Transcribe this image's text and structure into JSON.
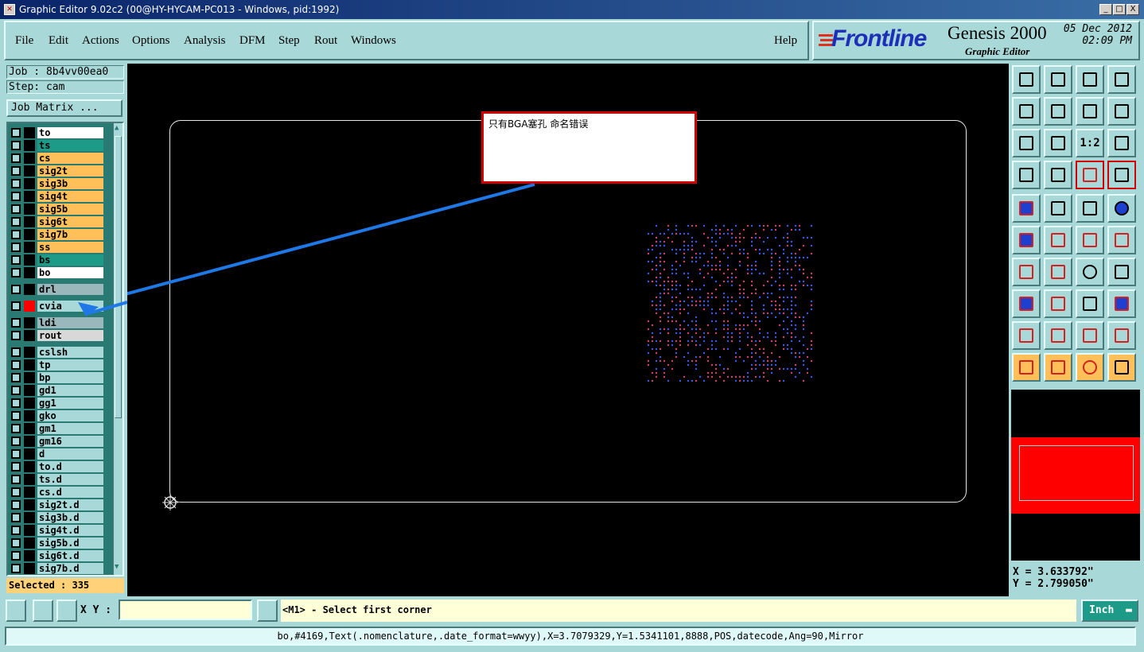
{
  "window": {
    "title": "Graphic Editor 9.02c2 (00@HY-HYCAM-PC013 - Windows, pid:1992)",
    "min": "_",
    "max": "□",
    "close": "X"
  },
  "menu": [
    "File",
    "Edit",
    "Actions",
    "Options",
    "Analysis",
    "DFM",
    "Step",
    "Rout",
    "Windows"
  ],
  "help_label": "Help",
  "brand": {
    "logo": "Frontline",
    "product": "Genesis 2000",
    "subtitle": "Graphic Editor",
    "date": "05 Dec 2012",
    "time": "02:09 PM"
  },
  "job": {
    "job_line": "Job : 8b4vv00ea0",
    "step_line": "Step: cam",
    "matrix_button": "Job Matrix ..."
  },
  "layers": [
    {
      "name": "to",
      "color": "#ffffff",
      "swatch": "#000000"
    },
    {
      "name": "ts",
      "color": "#1e9a88",
      "swatch": "#000000"
    },
    {
      "name": "cs",
      "color": "#ffc05a",
      "swatch": "#000000"
    },
    {
      "name": "sig2t",
      "color": "#ffc05a",
      "swatch": "#000000"
    },
    {
      "name": "sig3b",
      "color": "#ffc05a",
      "swatch": "#000000"
    },
    {
      "name": "sig4t",
      "color": "#ffc05a",
      "swatch": "#000000"
    },
    {
      "name": "sig5b",
      "color": "#ffc05a",
      "swatch": "#000000"
    },
    {
      "name": "sig6t",
      "color": "#ffc05a",
      "swatch": "#000000"
    },
    {
      "name": "sig7b",
      "color": "#ffc05a",
      "swatch": "#000000"
    },
    {
      "name": "ss",
      "color": "#ffc05a",
      "swatch": "#000000"
    },
    {
      "name": "bs",
      "color": "#1e9a88",
      "swatch": "#000000"
    },
    {
      "name": "bo",
      "color": "#ffffff",
      "swatch": "#000000"
    },
    {
      "name": "drl",
      "color": "#9ab8bc",
      "swatch": "#000000"
    },
    {
      "name": "cvia",
      "color": "#a9d8d8",
      "swatch": "#ff0000"
    },
    {
      "name": "ldi",
      "color": "#9ab8bc",
      "swatch": "#000000"
    },
    {
      "name": "rout",
      "color": "#d8d8d8",
      "swatch": "#000000"
    },
    {
      "name": "cslsh",
      "color": "#a9d8d8",
      "swatch": "#000000"
    },
    {
      "name": "tp",
      "color": "#a9d8d8",
      "swatch": "#000000"
    },
    {
      "name": "bp",
      "color": "#a9d8d8",
      "swatch": "#000000"
    },
    {
      "name": "gd1",
      "color": "#a9d8d8",
      "swatch": "#000000"
    },
    {
      "name": "gg1",
      "color": "#a9d8d8",
      "swatch": "#000000"
    },
    {
      "name": "gko",
      "color": "#a9d8d8",
      "swatch": "#000000"
    },
    {
      "name": "gm1",
      "color": "#a9d8d8",
      "swatch": "#000000"
    },
    {
      "name": "gm16",
      "color": "#a9d8d8",
      "swatch": "#000000"
    },
    {
      "name": "d",
      "color": "#a9d8d8",
      "swatch": "#000000"
    },
    {
      "name": "to.d",
      "color": "#a9d8d8",
      "swatch": "#000000"
    },
    {
      "name": "ts.d",
      "color": "#a9d8d8",
      "swatch": "#000000"
    },
    {
      "name": "cs.d",
      "color": "#a9d8d8",
      "swatch": "#000000"
    },
    {
      "name": "sig2t.d",
      "color": "#a9d8d8",
      "swatch": "#000000"
    },
    {
      "name": "sig3b.d",
      "color": "#a9d8d8",
      "swatch": "#000000"
    },
    {
      "name": "sig4t.d",
      "color": "#a9d8d8",
      "swatch": "#000000"
    },
    {
      "name": "sig5b.d",
      "color": "#a9d8d8",
      "swatch": "#000000"
    },
    {
      "name": "sig6t.d",
      "color": "#a9d8d8",
      "swatch": "#000000"
    },
    {
      "name": "sig7b.d",
      "color": "#a9d8d8",
      "swatch": "#000000"
    }
  ],
  "selected": "Selected : 335",
  "annotation": "只有BGA塞孔  命名错误",
  "coords": {
    "x": "X = 3.633792\"",
    "y": "Y = 2.799050\""
  },
  "bottom": {
    "xy_label": "X Y :",
    "xy_value": "",
    "prompt": "<M1> - Select first corner",
    "unit": "Inch"
  },
  "status": "bo,#4169,Text(.nomenclature,.date_format=wwyy),X=3.7079329,Y=1.5341101,8888,POS,datecode,Ang=90,Mirror",
  "toolbar_icons": [
    "home-icon",
    "zoom-home-icon",
    "house-icon",
    "grid-corner-icon",
    "pan-left-icon",
    "pan-right-icon",
    "flip-icon",
    "step-s-icon",
    "fit-width-icon",
    "fit-height-icon",
    "scale-1-2-icon",
    "help-query-icon",
    "palette-icon",
    "grid-icon",
    "layer-red-icon",
    "layer-net-icon",
    "pad-select-icon",
    "polygon-icon",
    "ruler-icon",
    "dot-icon",
    "connect-icon",
    "cross-icon",
    "point-add-icon",
    "point-move-icon",
    "line-add-icon",
    "line-blue-icon",
    "arc-icon",
    "edit-f-icon",
    "pad-red-icon",
    "line-minus-icon",
    "measure-icon",
    "pad-blue-icon",
    "triangle-arrow-icon",
    "triangle-a-icon",
    "triangle-up-icon",
    "triangle-base-icon",
    "pointer-icon",
    "pointer-box-icon",
    "pointer-circle-icon",
    "net-select-icon"
  ],
  "scale_label": "1:2"
}
